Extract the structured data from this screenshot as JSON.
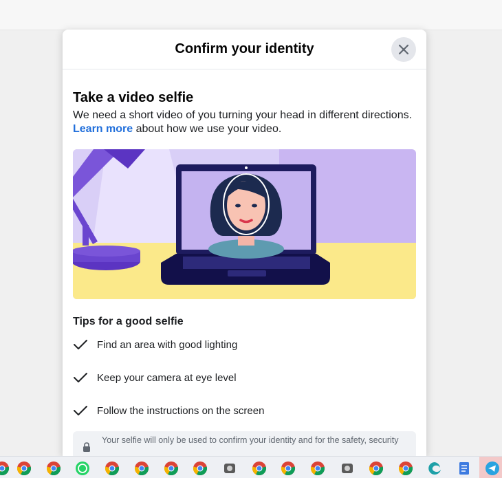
{
  "modal": {
    "title": "Confirm your identity"
  },
  "content": {
    "heading": "Take a video selfie",
    "description_before": "We need a short video of you turning your head in different directions.",
    "learn_more": "Learn more",
    "description_after": "about how we use your video."
  },
  "tips": {
    "title": "Tips for a good selfie",
    "items": [
      "Find an area with good lighting",
      "Keep your camera at eye level",
      "Follow the instructions on the screen"
    ]
  },
  "notice": {
    "text": "Your selfie will only be used to confirm your identity and for the safety, security"
  },
  "taskbar": {
    "icons": [
      "chrome-icon",
      "chrome-icon",
      "chrome-icon",
      "whatsapp-icon",
      "chrome-icon",
      "chrome-icon",
      "chrome-icon",
      "chrome-icon",
      "app-icon",
      "chrome-icon",
      "chrome-icon",
      "chrome-icon",
      "app-icon",
      "chrome-icon",
      "chrome-icon",
      "edge-icon",
      "notepad-icon",
      "telegram-icon"
    ]
  },
  "colors": {
    "link": "#216fdb",
    "illustration_bg": "#c9b6f2",
    "desk": "#fbe98a",
    "laptop": "#1d1b5e"
  }
}
